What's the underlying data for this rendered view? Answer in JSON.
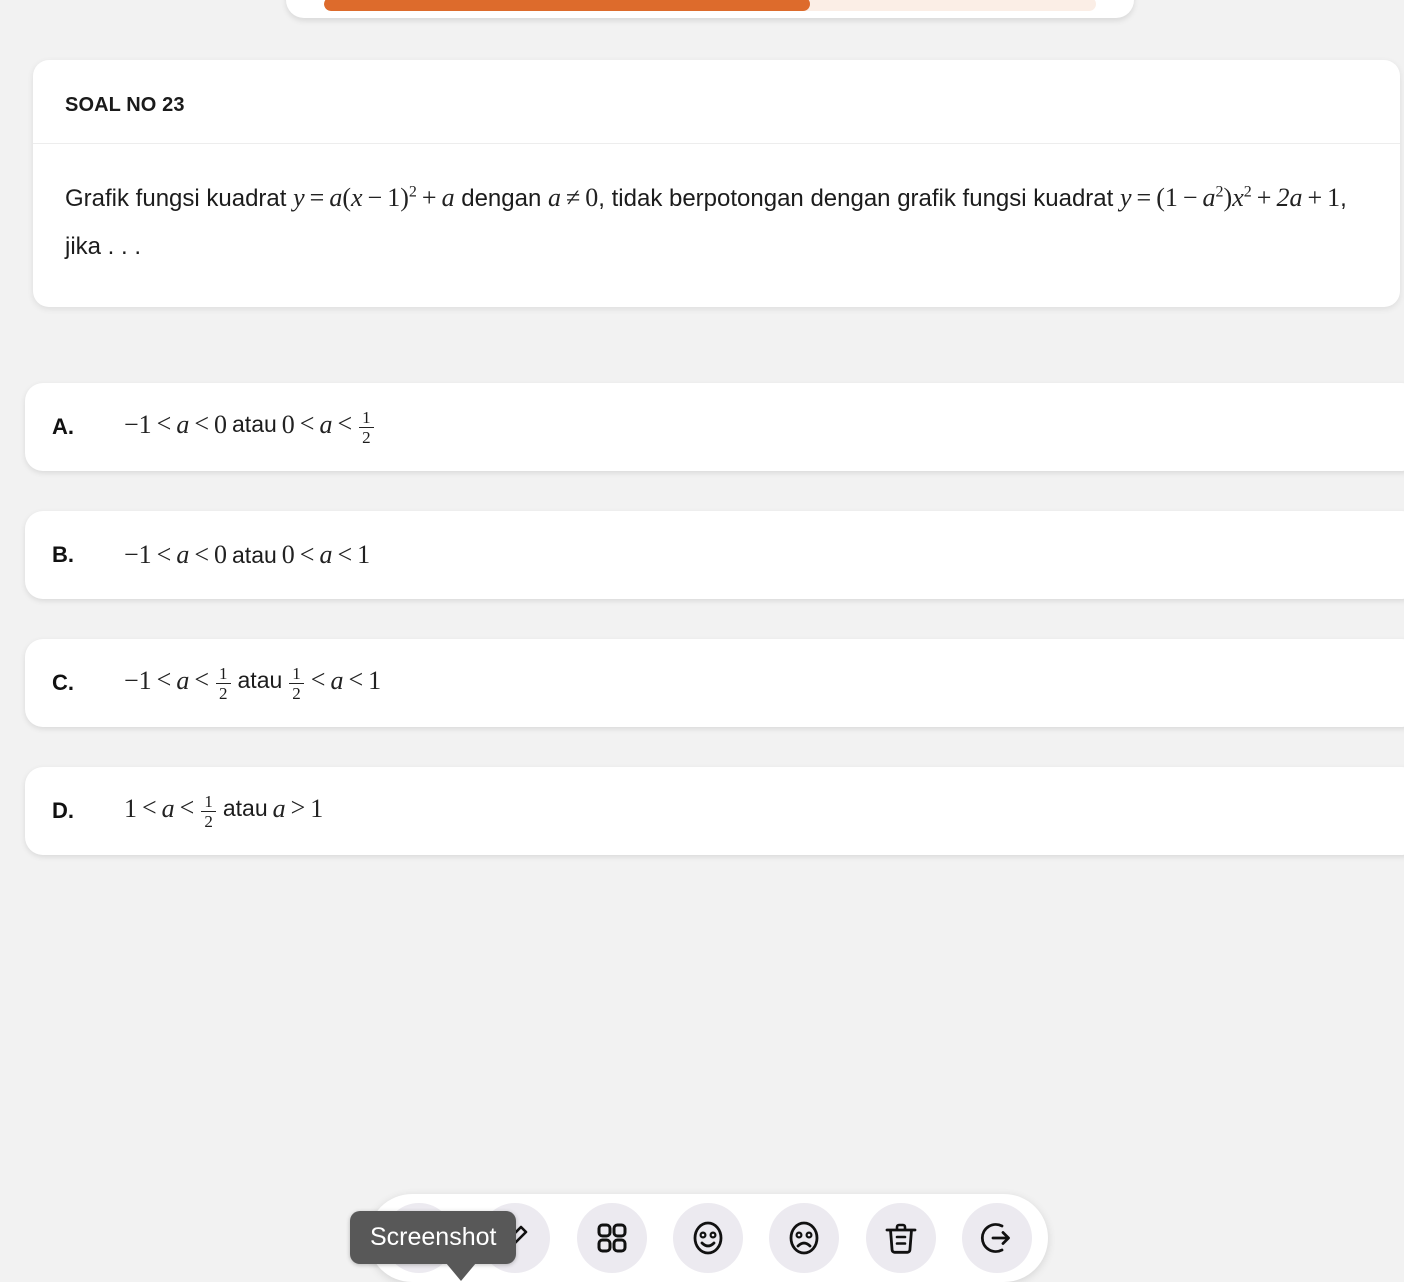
{
  "background_color": "#f2f2f2",
  "progress": {
    "accent_color": "#dd6b2c",
    "track_color": "#fbeee6",
    "percent": 63
  },
  "question": {
    "header_title": "SOAL NO 23",
    "line1_pre": "Grafik fungsi kuadrat",
    "line1_math1_y": "y",
    "line1_math1_eq": "=",
    "line1_math1_a": "a",
    "line1_math1_paren_open": "(",
    "line1_math1_x": "x",
    "line1_math1_minus": "−",
    "line1_math1_one": "1",
    "line1_math1_paren_close": ")",
    "line1_math1_exp": "2",
    "line1_math1_plus": "+",
    "line1_math1_a2": "a",
    "line1_mid": "dengan",
    "line1_math2_a": "a",
    "line1_math2_neq": "≠",
    "line1_math2_zero": "0",
    "line1_post": ", tidak berpotongan dengan grafik fungsi kuadrat",
    "line2_math_y": "y",
    "line2_math_eq": "=",
    "line2_math_paren_open": "(",
    "line2_math_one": "1",
    "line2_math_minus": "−",
    "line2_math_a": "a",
    "line2_math_a_exp": "2",
    "line2_math_paren_close": ")",
    "line2_math_x": "x",
    "line2_math_x_exp": "2",
    "line2_math_plus": "+",
    "line2_math_two_a": "2a",
    "line2_math_plus2": "+",
    "line2_math_one2": "1",
    "line2_post": ", jika . . ."
  },
  "options": [
    {
      "letter": "A.",
      "left_lower": "−1",
      "left_rel1": "<",
      "left_var": "a",
      "left_rel2": "<",
      "left_upper": "0",
      "conj": "atau",
      "right_lower": "0",
      "right_rel1": "<",
      "right_var": "a",
      "right_rel2": "<",
      "right_upper_num": "1",
      "right_upper_den": "2",
      "right_upper_is_fraction": true
    },
    {
      "letter": "B.",
      "left_lower": "−1",
      "left_rel1": "<",
      "left_var": "a",
      "left_rel2": "<",
      "left_upper": "0",
      "conj": "atau",
      "right_lower": "0",
      "right_rel1": "<",
      "right_var": "a",
      "right_rel2": "<",
      "right_upper": "1",
      "right_upper_is_fraction": false
    },
    {
      "letter": "C.",
      "left_lower": "−1",
      "left_rel1": "<",
      "left_var": "a",
      "left_rel2": "<",
      "left_upper_num": "1",
      "left_upper_den": "2",
      "left_upper_is_fraction": true,
      "conj": "atau",
      "right_lower_num": "1",
      "right_lower_den": "2",
      "right_lower_is_fraction": true,
      "right_rel1": "<",
      "right_var": "a",
      "right_rel2": "<",
      "right_upper": "1",
      "right_upper_is_fraction": false
    },
    {
      "letter": "D.",
      "left_lower": "1",
      "left_rel1": "<",
      "left_var": "a",
      "left_rel2": "<",
      "left_upper_num": "1",
      "left_upper_den": "2",
      "left_upper_is_fraction": true,
      "conj": "atau",
      "right_var": "a",
      "right_rel1": ">",
      "right_upper": "1",
      "right_upper_is_fraction": false
    }
  ],
  "toolbar": {
    "tooltip_label": "Screenshot",
    "tooltip_bg": "#585858",
    "buttons": [
      {
        "name": "screenshot-button",
        "icon": "camera-icon"
      },
      {
        "name": "annotate-button",
        "icon": "pen-icon"
      },
      {
        "name": "apps-grid-button",
        "icon": "grid-icon"
      },
      {
        "name": "thumbs-up-button",
        "icon": "happy-face-icon"
      },
      {
        "name": "thumbs-down-button",
        "icon": "sad-face-icon"
      },
      {
        "name": "delete-button",
        "icon": "trash-icon"
      },
      {
        "name": "exit-button",
        "icon": "exit-icon"
      }
    ]
  }
}
